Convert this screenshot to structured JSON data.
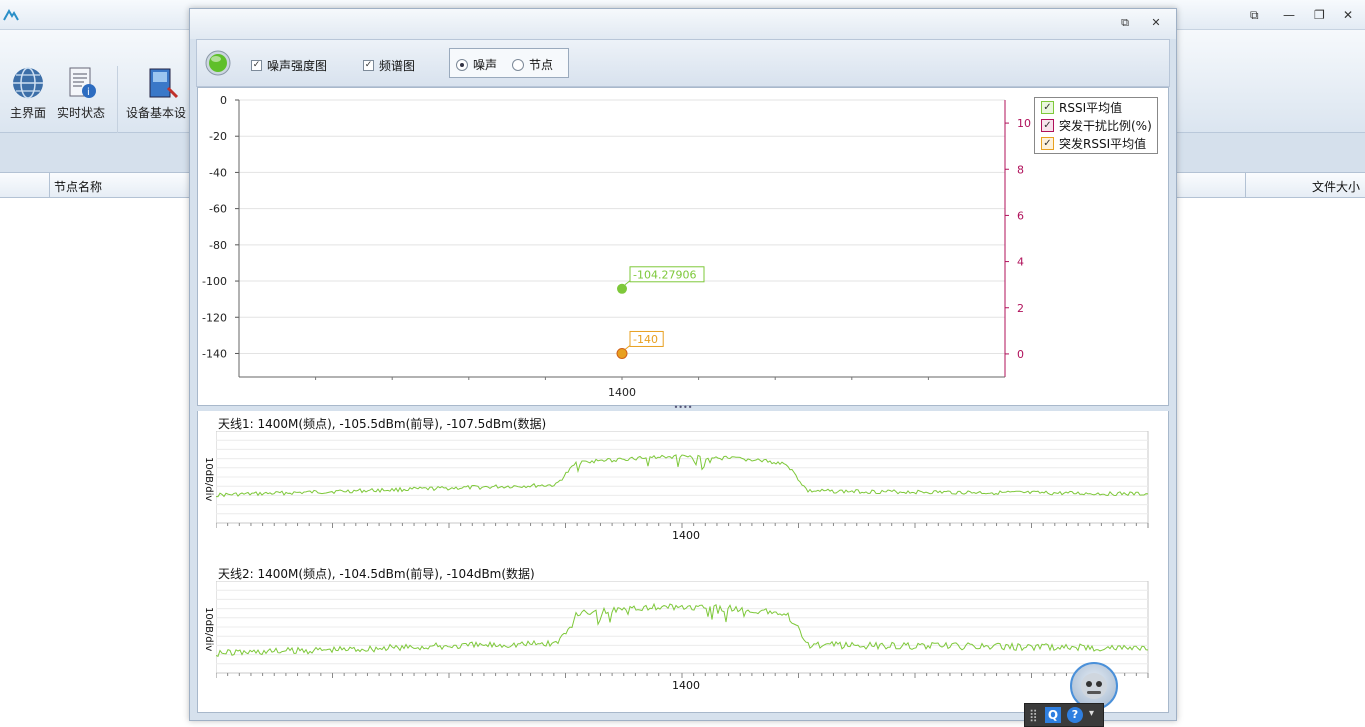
{
  "ribbon": {
    "buttons": [
      {
        "label": "主界面",
        "icon": "globe-icon"
      },
      {
        "label": "实时状态",
        "icon": "document-info-icon"
      },
      {
        "label": "设备基本设",
        "icon": "device-settings-icon"
      }
    ]
  },
  "table": {
    "headers": [
      "节点名称",
      "文件大小"
    ]
  },
  "dialog": {
    "toolbar": {
      "status_color": "#5fbf2a",
      "checks": [
        {
          "label": "噪声强度图",
          "checked": true
        },
        {
          "label": "频谱图",
          "checked": true
        }
      ],
      "radios": [
        {
          "label": "噪声",
          "selected": true
        },
        {
          "label": "节点",
          "selected": false
        }
      ]
    }
  },
  "chart_data": [
    {
      "type": "scatter",
      "x_ticks": [
        "1400"
      ],
      "y_left_ticks": [
        "0",
        "-20",
        "-40",
        "-60",
        "-80",
        "-100",
        "-120",
        "-140"
      ],
      "y_right_ticks": [
        "10",
        "8",
        "6",
        "4",
        "2",
        "0"
      ],
      "ylim_left": [
        -153,
        0
      ],
      "ylim_right": [
        -1,
        11
      ],
      "legend": [
        {
          "name": "RSSI平均值",
          "color": "#7ec83a"
        },
        {
          "name": "突发干扰比例(%)",
          "color": "#b0105a"
        },
        {
          "name": "突发RSSI平均值",
          "color": "#e8a020"
        }
      ],
      "series": [
        {
          "name": "RSSI平均值",
          "x": [
            1400
          ],
          "y": [
            -104.27906
          ],
          "label": "-104.27906",
          "color": "#7ec83a"
        },
        {
          "name": "突发RSSI平均值",
          "x": [
            1400
          ],
          "y": [
            -140
          ],
          "label": "-140",
          "color": "#e8a020"
        }
      ]
    },
    {
      "type": "line",
      "title": "天线1: 1400M(频点), -105.5dBm(前导), -107.5dBm(数据)",
      "ylabel": "10dB/div",
      "x_ticks": [
        "1400"
      ],
      "color": "#7ec83a"
    },
    {
      "type": "line",
      "title": "天线2: 1400M(频点), -104.5dBm(前导), -104dBm(数据)",
      "ylabel": "10dB/div",
      "x_ticks": [
        "1400"
      ],
      "color": "#7ec83a"
    }
  ]
}
